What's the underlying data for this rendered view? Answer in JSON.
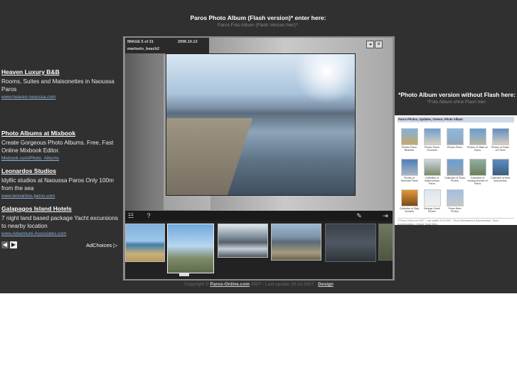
{
  "header": {
    "title": "Paros Photo Album (Flash version)* enter here:",
    "subtitle": "Paros Foto Album (Flash Version hier)*:"
  },
  "ads": [
    {
      "title": "Heaven Luxury B&B",
      "text": "Rooms, Suites and Maisonettes in Naoussa Paros",
      "url": "www.heaven-naoussa.com"
    },
    {
      "title": "Photo Albums at Mixbook",
      "text": "Create Gorgeous Photo Albums. Free, Fast Online Mixbook Editor.",
      "url": "Mixbook.com/Photo_Albums"
    },
    {
      "title": "Leonardos Studios",
      "text": "Idyllic studios at Naoussa Paros Only 100m from the sea",
      "url": "www.leonardos-paros.com"
    },
    {
      "title": "Galapagos Island Hotels",
      "text": "7 night land based package Yacht excursions to nearby location",
      "url": "www.Adventure-Associates.com"
    }
  ],
  "ad_nav": {
    "prev": "◀",
    "next": "▶",
    "adchoices": "AdChoices ▷"
  },
  "album": {
    "image_counter": "IMAGE  5 of 21",
    "date": "2006.10.13",
    "caption": "martselo_beach2",
    "btn_minimize": "◂",
    "btn_close": "✕",
    "toolbar": {
      "grid_icon": "☷",
      "help_icon": "?",
      "edit_icon": "✎",
      "exit_icon": "⇥"
    }
  },
  "footer": {
    "prefix": "Copyright © ",
    "site": "Paros-Online.com",
    "middle": " 2007 - Last update 26.10.2007 - ",
    "design": "Design"
  },
  "right": {
    "title": "*Photo Album version without Flash here:",
    "subtitle": "*Foto Album ohne Flash hier:",
    "preview_title": "Paros Photos, Updates, Greece, Photo Album",
    "preview_items": [
      "Photos Paros Beaches",
      "Photos Paros Churches",
      "Photos Paros",
      "Photos of Villas on Paros",
      "Photos of Cafes on Paros",
      "Photos of Tavernas Paros",
      "Collection of Island photos Paros",
      "Collection of Tours Photos",
      "Collection of holiday pictures of Paros",
      "Collection of best boat photos",
      "Collection of Stay Sunsets",
      "Strange Greek Photos",
      "Paros More Photos"
    ],
    "preview_footer": "© Paros-Online.com 2007 - Last update 26.10.2007 - Paros Webmasters & Administration - Book - Accommodation - Greece Travel Sites"
  },
  "colors": {
    "background": "#303030",
    "link": "#8fb0d0"
  }
}
